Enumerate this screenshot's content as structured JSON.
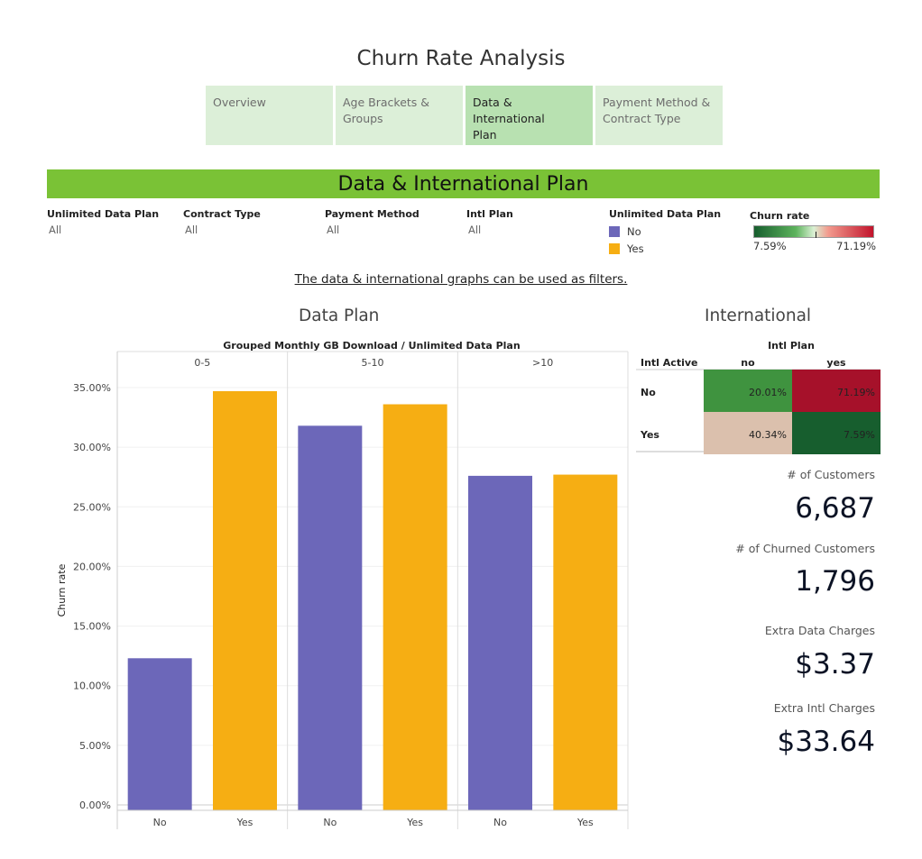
{
  "title": "Churn Rate Analysis",
  "tabs": [
    {
      "line1": "Overview",
      "line2": ""
    },
    {
      "line1": "Age Brackets &",
      "line2": "Groups"
    },
    {
      "line1": "Data & International",
      "line2": "Plan"
    },
    {
      "line1": "Payment Method &",
      "line2": "Contract Type"
    }
  ],
  "active_tab": 2,
  "banner": "Data & International Plan",
  "filters": [
    {
      "label": "Unlimited Data Plan",
      "value": "All"
    },
    {
      "label": "Contract Type",
      "value": "All"
    },
    {
      "label": "Payment Method",
      "value": "All"
    },
    {
      "label": "Intl Plan",
      "value": "All"
    }
  ],
  "color_legend": {
    "title": "Unlimited Data Plan",
    "items": [
      {
        "label": "No",
        "color": "#6c67b9"
      },
      {
        "label": "Yes",
        "color": "#f6ae13"
      }
    ]
  },
  "churn_legend": {
    "title": "Churn rate",
    "min": "7.59%",
    "max": "71.19%"
  },
  "note": "The data & international graphs can be used as filters.",
  "data_plan_title": "Data Plan",
  "international_title": "International",
  "chart_data": [
    {
      "type": "bar",
      "header": "Grouped Monthly GB Download / Unlimited Data Plan",
      "groups": [
        "0-5",
        "5-10",
        ">10"
      ],
      "categories": [
        "No",
        "Yes"
      ],
      "series": [
        {
          "group": "0-5",
          "values": [
            12.3,
            34.7
          ]
        },
        {
          "group": "5-10",
          "values": [
            31.8,
            33.6
          ]
        },
        {
          "group": ">10",
          "values": [
            27.6,
            27.7
          ]
        }
      ],
      "colors": [
        "#6c67b9",
        "#f6ae13"
      ],
      "ylabel": "Churn rate",
      "ylim": [
        0,
        35
      ],
      "yticks": [
        "0.00%",
        "5.00%",
        "10.00%",
        "15.00%",
        "20.00%",
        "25.00%",
        "30.00%",
        "35.00%"
      ],
      "grid": true
    },
    {
      "type": "heatmap",
      "col_header": "Intl Plan",
      "row_header": "Intl Active",
      "columns": [
        "no",
        "yes"
      ],
      "rows": [
        {
          "label": "No",
          "values": [
            "20.01%",
            "71.19%"
          ]
        },
        {
          "label": "Yes",
          "values": [
            "40.34%",
            "7.59%"
          ]
        }
      ],
      "colors": [
        [
          "#3f933f",
          "#a6112a"
        ],
        [
          "#dbc0ad",
          "#175e2e"
        ]
      ]
    }
  ],
  "kpis": [
    {
      "label": "# of Customers",
      "value": "6,687"
    },
    {
      "label": "# of Churned Customers",
      "value": "1,796"
    },
    {
      "label": "Extra Data Charges",
      "value": "$3.37"
    },
    {
      "label": "Extra Intl Charges",
      "value": "$33.64"
    }
  ]
}
